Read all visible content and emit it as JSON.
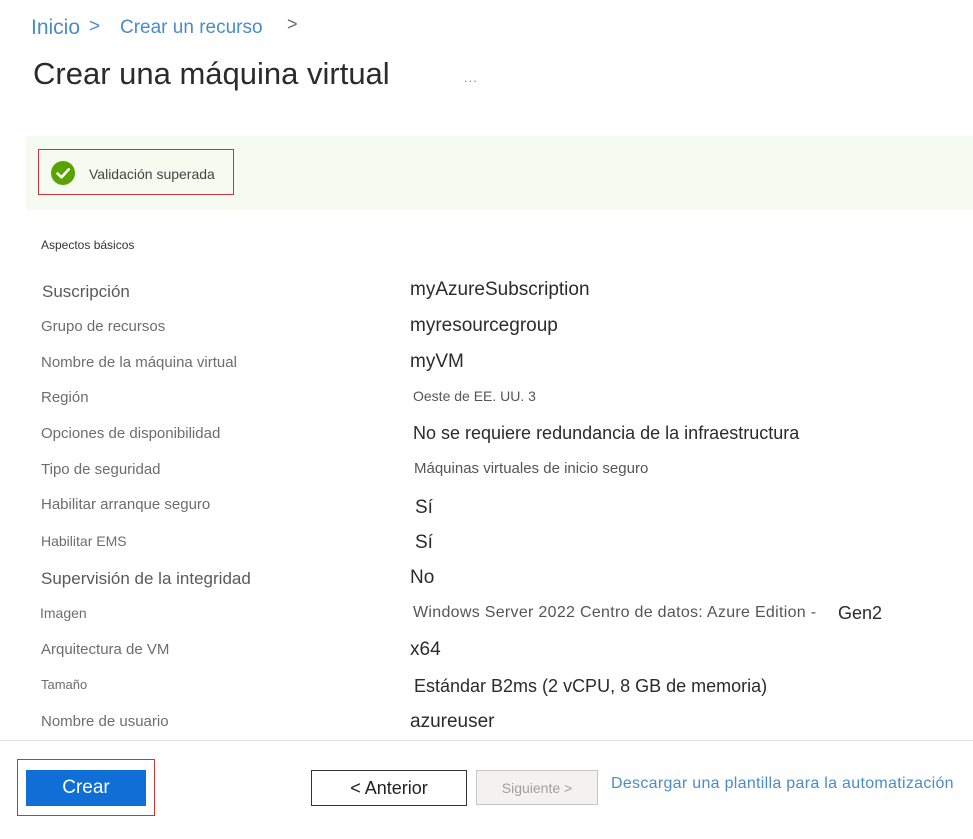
{
  "breadcrumb": {
    "home": "Inicio",
    "separator": ">",
    "current": "Crear un recurso",
    "chevron": ">"
  },
  "page": {
    "title": "Crear una máquina virtual",
    "more": "..."
  },
  "banner": {
    "status_icon": "check-circle-icon",
    "text": "Validación superada",
    "accent_color": "#57a300",
    "background_color": "#f6fbf1"
  },
  "section": {
    "title": "Aspectos básicos",
    "rows": [
      {
        "label": "Suscripción",
        "value": "myAzureSubscription"
      },
      {
        "label": "Grupo de recursos",
        "value": "myresourcegroup"
      },
      {
        "label": "Nombre de la máquina virtual",
        "value": "myVM"
      },
      {
        "label": "Región",
        "value": "Oeste de EE. UU. 3"
      },
      {
        "label": "Opciones de disponibilidad",
        "value": "No se requiere redundancia de la infraestructura"
      },
      {
        "label": "Tipo de seguridad",
        "value": "Máquinas virtuales de inicio seguro"
      },
      {
        "label": "Habilitar arranque seguro",
        "value": "Sí"
      },
      {
        "label": "Habilitar EMS",
        "value": "Sí"
      },
      {
        "label": "Supervisión de la integridad",
        "value": "No"
      },
      {
        "label": "Imagen",
        "value": "Windows Server 2022 Centro de datos: Azure Edition -",
        "value_suffix": "Gen2"
      },
      {
        "label": "Arquitectura de VM",
        "value": "x64"
      },
      {
        "label": "Tamaño",
        "value": "Estándar B2ms (2 vCPU, 8 GB de memoria)"
      },
      {
        "label": "Nombre de usuario",
        "value": "azureuser"
      }
    ]
  },
  "footer": {
    "create_label": "Crear",
    "prev_label": "< Anterior",
    "next_label": "Siguiente >",
    "download_link": "Descargar una plantilla para la automatización",
    "primary_color": "#0f6fd6",
    "highlight_color": "#d13438"
  }
}
